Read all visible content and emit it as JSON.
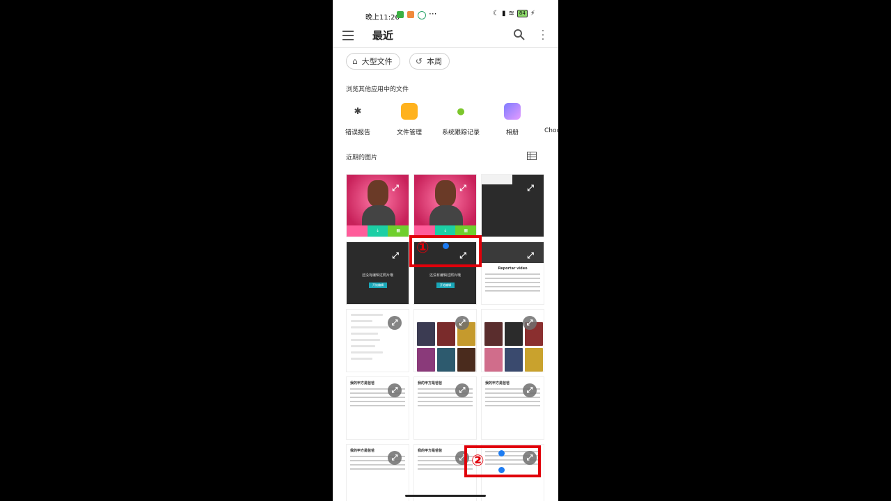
{
  "status_bar": {
    "time": "晚上11:26",
    "more": "···",
    "battery": "84"
  },
  "app_bar": {
    "title": "最近"
  },
  "chips": [
    {
      "label": "大型文件"
    },
    {
      "label": "本周"
    }
  ],
  "browse_section": {
    "label": "浏览其他应用中的文件"
  },
  "apps": [
    {
      "label": "错误报告"
    },
    {
      "label": "文件管理"
    },
    {
      "label": "系统跟踪记录"
    },
    {
      "label": "相册"
    },
    {
      "label": "Choo"
    }
  ],
  "recent_section": {
    "label": "近期的图片"
  },
  "tiles": {
    "dark_msg": "还没有编辑过照片哦",
    "dark_btn": "开始编辑",
    "card_title": "我的甲方是爸爸",
    "report_title": "Reportar video"
  },
  "markers": [
    {
      "label": "①"
    },
    {
      "label": "②"
    }
  ],
  "colors": {
    "marker": "#e0000a",
    "dot": "#1d7cf2"
  }
}
